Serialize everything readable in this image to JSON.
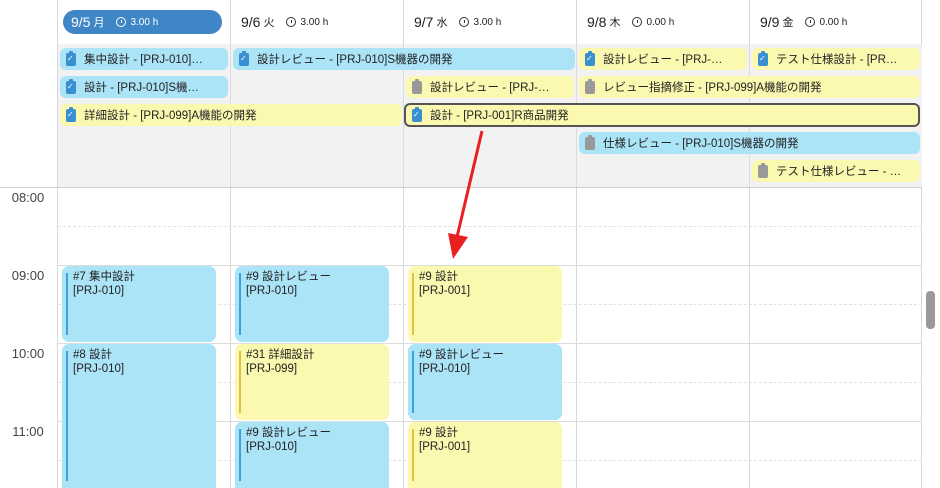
{
  "days": [
    {
      "date": "9/5",
      "dow": "月",
      "hours": "3.00 h",
      "active": true
    },
    {
      "date": "9/6",
      "dow": "火",
      "hours": "3.00 h"
    },
    {
      "date": "9/7",
      "dow": "水",
      "hours": "3.00 h"
    },
    {
      "date": "9/8",
      "dow": "木",
      "hours": "0.00 h"
    },
    {
      "date": "9/9",
      "dow": "金",
      "hours": "0.00 h"
    }
  ],
  "allday_events": [
    {
      "label": "集中設計 - [PRJ-010]…",
      "color": "blue",
      "icon": "clipboard-check-icon"
    },
    {
      "label": "設計レビュー - [PRJ-010]S機器の開発",
      "color": "blue",
      "icon": "clipboard-check-icon"
    },
    {
      "label": "設計レビュー - [PRJ-…",
      "color": "yellow",
      "icon": "clipboard-check-icon"
    },
    {
      "label": "テスト仕様設計 - [PR…",
      "color": "yellow",
      "icon": "clipboard-check-icon"
    },
    {
      "label": "設計 - [PRJ-010]S機…",
      "color": "blue",
      "icon": "clipboard-check-icon"
    },
    {
      "label": "設計レビュー - [PRJ-…",
      "color": "yellow",
      "icon": "clipboard-icon"
    },
    {
      "label": "レビュー指摘修正 - [PRJ-099]A機能の開発",
      "color": "yellow",
      "icon": "clipboard-icon"
    },
    {
      "label": "詳細設計 - [PRJ-099]A機能の開発",
      "color": "yellow",
      "icon": "clipboard-check-icon"
    },
    {
      "label": "設計 - [PRJ-001]R商品開発",
      "color": "yellow",
      "icon": "clipboard-check-icon",
      "selected": true
    },
    {
      "label": "仕様レビュー - [PRJ-010]S機器の開発",
      "color": "blue",
      "icon": "clipboard-icon"
    },
    {
      "label": "テスト仕様レビュー - …",
      "color": "yellow",
      "icon": "clipboard-icon"
    }
  ],
  "times": [
    "08:00",
    "09:00",
    "10:00",
    "11:00"
  ],
  "blocks": [
    {
      "title": "#7 集中設計",
      "project": "[PRJ-010]",
      "color": "blue"
    },
    {
      "title": "#9 設計レビュー",
      "project": "[PRJ-010]",
      "color": "blue"
    },
    {
      "title": "#9 設計",
      "project": "[PRJ-001]",
      "color": "yellow"
    },
    {
      "title": "#8 設計",
      "project": "[PRJ-010]",
      "color": "blue"
    },
    {
      "title": "#31 詳細設計",
      "project": "[PRJ-099]",
      "color": "yellow"
    },
    {
      "title": "#9 設計レビュー",
      "project": "[PRJ-010]",
      "color": "blue"
    },
    {
      "title": "#9 設計レビュー",
      "project": "[PRJ-010]",
      "color": "blue"
    },
    {
      "title": "#9 設計",
      "project": "[PRJ-001]",
      "color": "yellow"
    }
  ],
  "colors": {
    "accent": "#3f86c7",
    "event_blue": "#abe3f7",
    "event_yellow": "#fbf8b0",
    "annotation_arrow": "#e82020"
  }
}
